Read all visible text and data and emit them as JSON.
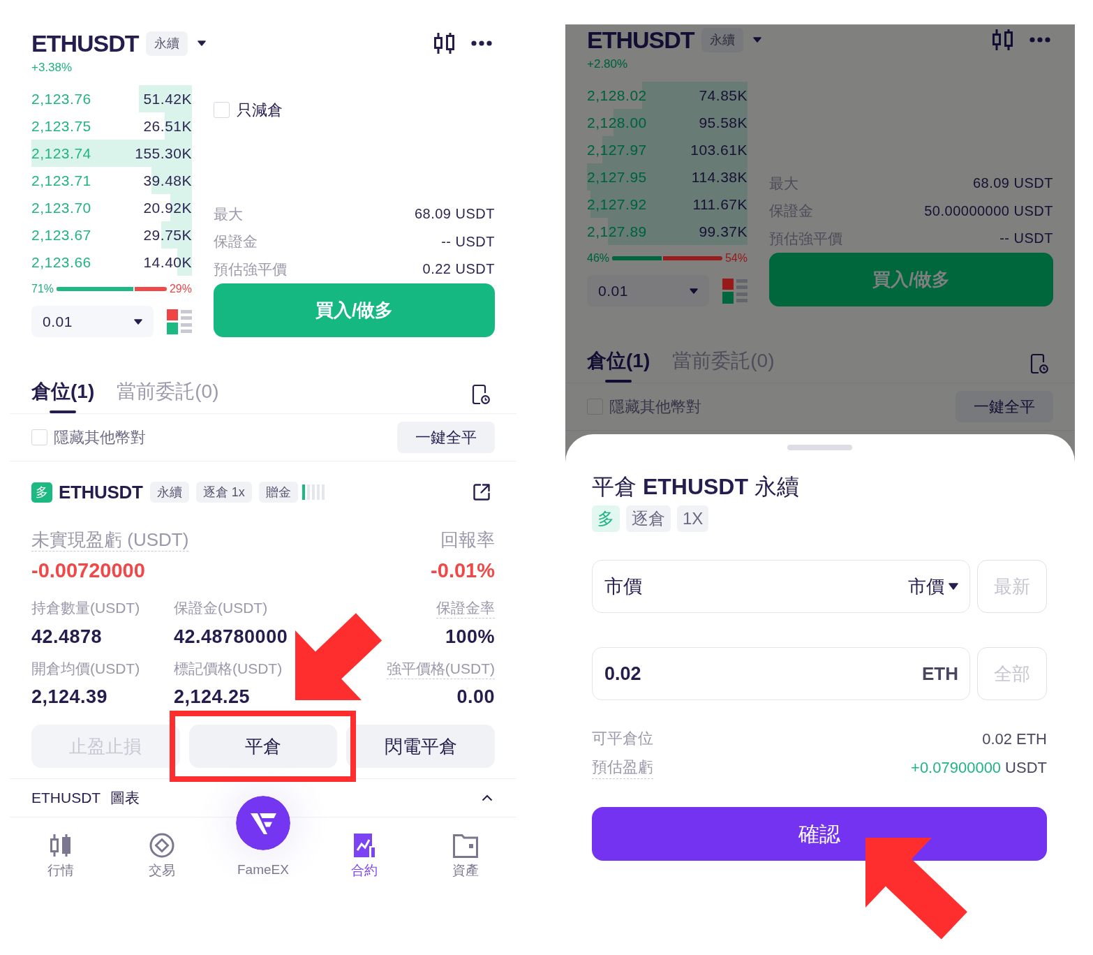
{
  "left_screen": {
    "header": {
      "symbol": "ETHUSDT",
      "contract": "永續",
      "change": "+3.38%"
    },
    "order_book": {
      "rows": [
        {
          "price": "2,123.76",
          "amount": "51.42K"
        },
        {
          "price": "2,123.75",
          "amount": "26.51K"
        },
        {
          "price": "2,123.74",
          "amount": "155.30K"
        },
        {
          "price": "2,123.71",
          "amount": "39.48K"
        },
        {
          "price": "2,123.70",
          "amount": "20.92K"
        },
        {
          "price": "2,123.67",
          "amount": "29.75K"
        },
        {
          "price": "2,123.66",
          "amount": "14.40K"
        }
      ],
      "ratio": {
        "buy": "71%",
        "sell": "29%",
        "level": 0.71
      },
      "quantity": "0.01"
    },
    "order_form": {
      "reduce_only": {
        "label": "只減倉",
        "checked": false
      },
      "rows": [
        {
          "label": "最大",
          "value": "68.09 USDT"
        },
        {
          "label": "保證金",
          "value": "-- USDT"
        },
        {
          "label": "預估強平價",
          "value": "0.22 USDT"
        }
      ],
      "submit": "買入/做多"
    },
    "tabs": [
      {
        "label": "倉位(1)",
        "selected": true
      },
      {
        "label": "當前委託(0)",
        "selected": false
      }
    ],
    "hide_other_pairs": {
      "label": "隱藏其他幣對",
      "checked": false
    },
    "close_all": "一鍵全平",
    "position": {
      "side": {
        "label": "多",
        "kind": "long"
      },
      "symbol": "ETHUSDT",
      "tags": [
        "永續",
        "逐倉 1x",
        "贈金"
      ],
      "adl": {
        "level": 0.2
      },
      "pnl": {
        "label": "未實現盈虧 (USDT)",
        "value": "-0.00720000",
        "underlined": true
      },
      "roe": {
        "label": "回報率",
        "value": "-0.01%",
        "underlined": false
      },
      "stats": [
        {
          "label": "持倉數量(USDT)",
          "value": "42.4878",
          "underlined": false
        },
        {
          "label": "保證金(USDT)",
          "value": "42.48780000",
          "underlined": false
        },
        {
          "label": "保證金率",
          "value": "100%",
          "underlined": true
        },
        {
          "label": "開倉均價(USDT)",
          "value": "2,124.39",
          "underlined": false
        },
        {
          "label": "標記價格(USDT)",
          "value": "2,124.25",
          "underlined": false
        },
        {
          "label": "強平價格(USDT)",
          "value": "0.00",
          "underlined": true
        }
      ],
      "actions": [
        {
          "label": "止盈止損",
          "disabled": true,
          "highlighted": false,
          "pointed_at": false
        },
        {
          "label": "平倉",
          "disabled": false,
          "highlighted": true,
          "pointed_at": true
        },
        {
          "label": "閃電平倉",
          "disabled": false,
          "highlighted": false,
          "pointed_at": false
        }
      ]
    },
    "chart_section": {
      "title": "ETHUSDT 圖表"
    },
    "bottom_nav": [
      {
        "kind": "market",
        "label": "行情",
        "selected": false
      },
      {
        "kind": "trade",
        "label": "交易",
        "selected": false
      },
      {
        "kind": "brand",
        "label": "FameEX",
        "selected": false
      },
      {
        "kind": "futures",
        "label": "合約",
        "selected": true
      },
      {
        "kind": "assets",
        "label": "資產",
        "selected": false
      }
    ]
  },
  "right_screen": {
    "header": {
      "symbol": "ETHUSDT",
      "contract": "永續",
      "change": "+2.80%"
    },
    "order_book": {
      "rows": [
        {
          "price": "2,128.02",
          "amount": "74.85K"
        },
        {
          "price": "2,128.00",
          "amount": "95.58K"
        },
        {
          "price": "2,127.97",
          "amount": "103.61K"
        },
        {
          "price": "2,127.95",
          "amount": "114.38K"
        },
        {
          "price": "2,127.92",
          "amount": "111.67K"
        },
        {
          "price": "2,127.89",
          "amount": "99.37K"
        }
      ],
      "ratio": {
        "buy": "46%",
        "sell": "54%",
        "level": 0.46
      },
      "quantity": "0.01"
    },
    "order_form": {
      "rows": [
        {
          "label": "最大",
          "value": "68.09 USDT"
        },
        {
          "label": "保證金",
          "value": "50.00000000 USDT"
        },
        {
          "label": "預估強平價",
          "value": "-- USDT"
        }
      ],
      "submit": "買入/做多"
    },
    "tabs": [
      {
        "label": "倉位(1)",
        "selected": true
      },
      {
        "label": "當前委託(0)",
        "selected": false
      }
    ],
    "hide_other_pairs": {
      "label": "隱藏其他幣對",
      "checked": false
    },
    "close_all": "一鍵全平",
    "close_sheet": {
      "title": "平倉 **ETHUSDT** 永續",
      "tags": [
        {
          "label": "多",
          "kind": "side"
        },
        {
          "label": "逐倉",
          "kind": "plain"
        },
        {
          "label": "1X",
          "kind": "plain"
        }
      ],
      "price_field": {
        "value": "市價",
        "type": "市價",
        "button": {
          "label": "最新",
          "disabled": true
        }
      },
      "amount_field": {
        "value": "0.02",
        "unit": "ETH",
        "button": {
          "label": "全部",
          "disabled": true
        }
      },
      "info": [
        {
          "label": "可平倉位",
          "value": "0.02",
          "unit": "ETH",
          "color": "#4a4660",
          "underlined": false
        },
        {
          "label": "預估盈虧",
          "value": "+0.07900000",
          "unit": "USDT",
          "color": "#1fb583",
          "underlined": true
        }
      ],
      "confirm": {
        "label": "確認",
        "pointed_at": true
      }
    }
  }
}
